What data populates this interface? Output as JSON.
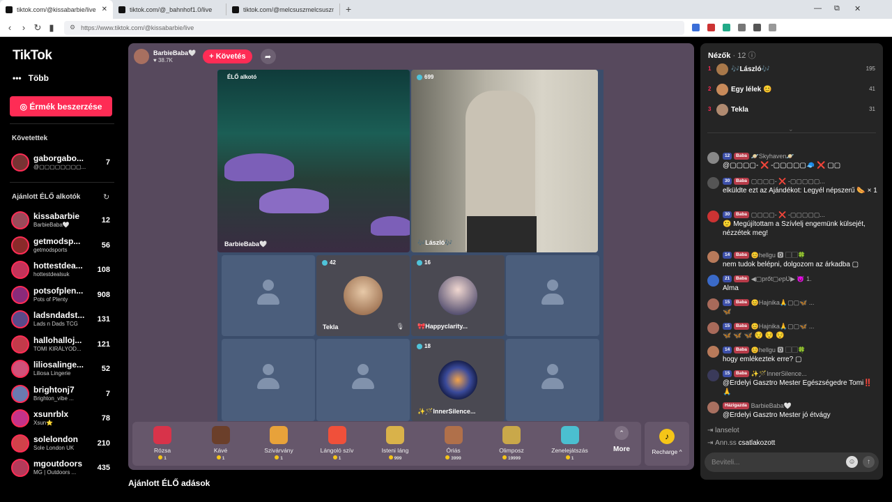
{
  "browser": {
    "tabs": [
      {
        "title": "tiktok.com/@kissabarbie/live",
        "active": true
      },
      {
        "title": "tiktok.com/@_bahnhof1.0/live",
        "active": false
      },
      {
        "title": "tiktok.com/@melcsuszmelcsuszmelcs",
        "active": false
      }
    ],
    "url": "https://www.tiktok.com/@kissabarbie/live"
  },
  "sidebar": {
    "logo": "TikTok",
    "more": "Több",
    "coins_button": "Érmék beszerzése",
    "following_title": "Követettek",
    "following": [
      {
        "name": "gaborgabo...",
        "sub": "@▢▢▢▢▢▢▢▢...",
        "count": "7"
      }
    ],
    "recommended_title": "Ajánlott ÉLŐ alkotók",
    "recommended": [
      {
        "name": "kissabarbie",
        "sub": "BarbieBaba🤍",
        "count": "12"
      },
      {
        "name": "getmodsp...",
        "sub": "getmodsports",
        "count": "56"
      },
      {
        "name": "hottestdea...",
        "sub": "hottestdealsuk",
        "count": "108"
      },
      {
        "name": "potsofplen...",
        "sub": "Pots of Plenty",
        "count": "908"
      },
      {
        "name": "ladsndadst...",
        "sub": "Lads n Dads TCG",
        "count": "131"
      },
      {
        "name": "hallohalloj...",
        "sub": "TOMI KIRÁLYOD...",
        "count": "121"
      },
      {
        "name": "liliosalinge...",
        "sub": "Liliosa Lingerie",
        "count": "52"
      },
      {
        "name": "brightonj7",
        "sub": "Brighton_vibe ...",
        "count": "7"
      },
      {
        "name": "xsunrblx",
        "sub": "Xsun⭐",
        "count": "78"
      },
      {
        "name": "solelondon",
        "sub": "Sole London UK",
        "count": "210"
      },
      {
        "name": "mgoutdoors",
        "sub": "MG | Outdoors ...",
        "count": "435"
      }
    ]
  },
  "stream": {
    "host_name": "BarbieBaba🤍",
    "host_likes": "38.7K",
    "follow_label": "+ Követés",
    "main_label": "ÉLŐ alkotó",
    "main_name": "BarbieBaba🤍",
    "guest_main": {
      "count": "699",
      "name": "🎶László🎶"
    },
    "tiles": [
      {
        "count": "42",
        "name": "Tekla"
      },
      {
        "count": "16",
        "name": "🎀Happyclarity..."
      },
      {
        "count": "18",
        "name": "✨🪄InnerSilence..."
      }
    ]
  },
  "gifts": [
    {
      "name": "Rózsa",
      "price": "1",
      "color": "#d8334a"
    },
    {
      "name": "Kávé",
      "price": "1",
      "color": "#6b3f2a"
    },
    {
      "name": "Szivárvány",
      "price": "1",
      "color": "#e8a23a"
    },
    {
      "name": "Lángoló szív",
      "price": "1",
      "color": "#f0503a"
    },
    {
      "name": "Isteni láng",
      "price": "999",
      "color": "#d9b24a"
    },
    {
      "name": "Óriás",
      "price": "3999",
      "color": "#b0704a"
    },
    {
      "name": "Olimposz",
      "price": "19999",
      "color": "#c9a84a"
    },
    {
      "name": "Zenelejátszás",
      "price": "1",
      "color": "#4bbfd0"
    }
  ],
  "gifts_more": "More",
  "recharge": "Recharge ^",
  "recommended_section": "Ajánlott ÉLŐ adások",
  "chat": {
    "viewers_title": "Nézők",
    "viewers_count": "· 12",
    "top_viewers": [
      {
        "rank": "1",
        "name": "🎶László🎶",
        "score": "195"
      },
      {
        "rank": "2",
        "name": "Egy lélek 😊",
        "score": "41"
      },
      {
        "rank": "3",
        "name": "Tekla",
        "score": "31"
      }
    ],
    "messages": [
      {
        "level": "12",
        "tag": "Baba",
        "user": "🪐Skyhaven🪐",
        "text": "@▢▢▢▢- ❌ -▢▢▢▢▢🧢 ❌ ▢▢"
      },
      {
        "level": "30",
        "tag": "Baba",
        "user": "▢▢▢▢- ❌ -▢▢▢▢▢...",
        "text": "elküldte ezt az Ajándékot: Legyél népszerű 🌭 × 1"
      },
      {
        "level": "30",
        "tag": "Baba",
        "user": "▢▢▢▢- ❌ -▢▢▢▢▢...",
        "text": "🙂 Megújítottam a Szívlelj engemünk külsejét, nézzétek meg!"
      },
      {
        "level": "14",
        "tag": "Baba",
        "user": "😊hellgu 🅾 ▢▢🍀",
        "text": "nem tudok belépni, dolgozom az árkadba ▢"
      },
      {
        "level": "21",
        "tag": "Baba",
        "user": "◀▢prőt▢ℯpƲ▶ 😈 1.",
        "text": "Alma"
      },
      {
        "level": "15",
        "tag": "Baba",
        "user": "😊Hajnika🙏▢▢🦋 ...",
        "text": "🦋"
      },
      {
        "level": "15",
        "tag": "Baba",
        "user": "😊Hajnika🙏▢▢🦋 ...",
        "text": "🦋 🦋 🦋 😌 😌 😌"
      },
      {
        "level": "14",
        "tag": "Baba",
        "user": "😊hellgu 🅾 ▢▢🍀",
        "text": "hogy emlékeztek erre? ▢"
      },
      {
        "level": "15",
        "tag": "Baba",
        "user": "✨🪄InnerSilence...",
        "text": "@Erdelyi Gasztro Mester Egészségedre Tomi‼️🙏"
      },
      {
        "level": "",
        "tag": "Házigazda",
        "user": "BarbieBaba🤍",
        "text": "@Erdelyi Gasztro Mester jó étvágy"
      }
    ],
    "joins": [
      {
        "name": "lanselot",
        "action": ""
      },
      {
        "name": "Ann.ss",
        "action": "csatlakozott"
      }
    ],
    "input_placeholder": "Beviteli..."
  }
}
